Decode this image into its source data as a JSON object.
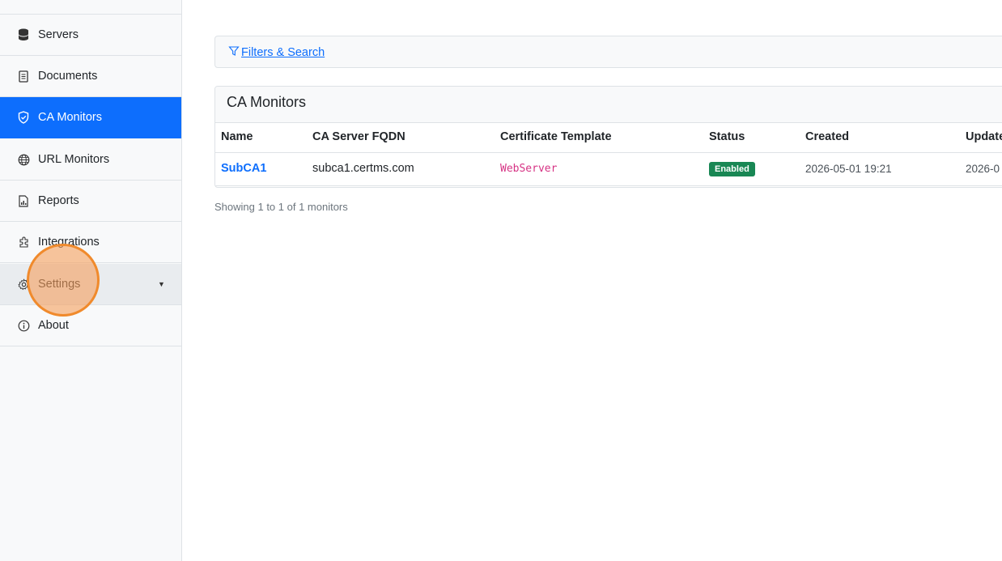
{
  "sidebar": {
    "items": [
      {
        "label": "Servers",
        "icon": "database-icon"
      },
      {
        "label": "Documents",
        "icon": "document-icon"
      },
      {
        "label": "CA Monitors",
        "icon": "shield-icon",
        "active": true
      },
      {
        "label": "URL Monitors",
        "icon": "globe-icon"
      },
      {
        "label": "Reports",
        "icon": "report-icon"
      },
      {
        "label": "Integrations",
        "icon": "plugin-icon"
      },
      {
        "label": "Settings",
        "icon": "gear-icon",
        "has_dropdown": true
      },
      {
        "label": "About",
        "icon": "info-icon"
      }
    ]
  },
  "filters": {
    "label": " Filters & Search"
  },
  "card": {
    "title": "CA Monitors",
    "columns": [
      "Name",
      "CA Server FQDN",
      "Certificate Template",
      "Status",
      "Created",
      "Update"
    ],
    "rows": [
      {
        "name": "SubCA1",
        "fqdn": "subca1.certms.com",
        "template": "WebServer",
        "status": "Enabled",
        "created": "2026-05-01 19:21",
        "updated": "2026-0"
      }
    ]
  },
  "footer": {
    "showing": "Showing 1 to 1 of 1 monitors"
  },
  "colors": {
    "primary": "#0d6efd",
    "success": "#198754",
    "template": "#d63384",
    "click_indicator": "#f08a2c"
  }
}
